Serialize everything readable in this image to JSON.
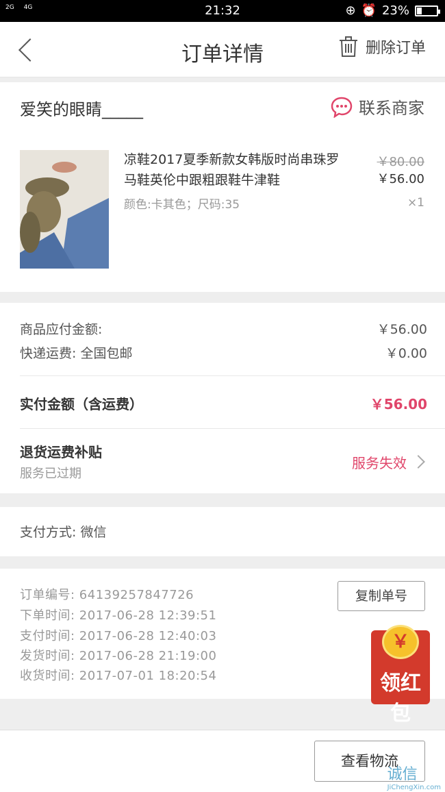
{
  "status_bar": {
    "signal_1": "2G",
    "signal_2": "4G",
    "time": "21:32",
    "battery": "23%",
    "battery_level": 0.23
  },
  "header": {
    "title": "订单详情",
    "delete_label": "删除订单"
  },
  "shop": {
    "name": "爱笑的眼睛_____",
    "contact_label": "联系商家"
  },
  "product": {
    "name": "凉鞋2017夏季新款女韩版时尚串珠罗马鞋英伦中跟粗跟鞋牛津鞋",
    "spec": "颜色:卡其色；尺码:35",
    "original_price": "￥80.00",
    "price": "￥56.00",
    "quantity": "×1"
  },
  "amounts": {
    "goods_label": "商品应付金额:",
    "goods_value": "￥56.00",
    "shipping_label": "快递运费:  全国包邮",
    "shipping_value": "￥0.00",
    "paid_label": "实付金额（含运费）",
    "paid_value": "￥56.00",
    "subsidy_title": "退货运费补贴",
    "subsidy_sub": "服务已过期",
    "subsidy_status": "服务失效"
  },
  "payment": {
    "method": "支付方式:  微信"
  },
  "order_info": {
    "order_no": "订单编号:  64139257847726",
    "order_time": "下单时间:  2017-06-28   12:39:51",
    "pay_time": "支付时间:  2017-06-28   12:40:03",
    "ship_time": "发货时间:  2017-06-28   21:19:00",
    "receive_time": "收货时间:  2017-07-01   18:20:54",
    "copy_label": "复制单号"
  },
  "red_packet": {
    "label": "领红包",
    "coin_symbol": "￥"
  },
  "bottom": {
    "logistics_label": "查看物流"
  },
  "watermark": {
    "text": "诚信",
    "sub": "JiChengXin.com"
  },
  "colors": {
    "accent_pink": "#e0456a",
    "red_packet": "#d33a2c"
  }
}
